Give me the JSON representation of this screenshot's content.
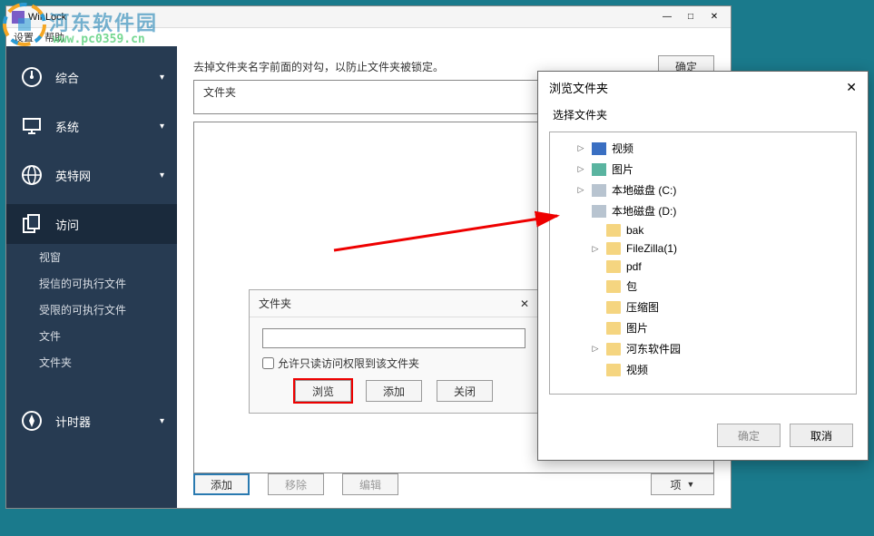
{
  "window": {
    "title": "WinLock"
  },
  "menu": {
    "item1": "设置",
    "item2": "帮助"
  },
  "sidebar": {
    "items": [
      {
        "label": "综合"
      },
      {
        "label": "系统"
      },
      {
        "label": "英特网"
      },
      {
        "label": "访问"
      },
      {
        "label": "计时器"
      }
    ],
    "sub": [
      {
        "label": "视窗"
      },
      {
        "label": "授信的可执行文件"
      },
      {
        "label": "受限的可执行文件"
      },
      {
        "label": "文件"
      },
      {
        "label": "文件夹"
      }
    ]
  },
  "panel": {
    "instruction": "去掉文件夹名字前面的对勾，以防止文件夹被锁定。",
    "list_header": "文件夹",
    "ok": "确定",
    "bottom": {
      "add": "添加",
      "remove": "移除",
      "edit": "编辑",
      "options": "项"
    }
  },
  "inner": {
    "title": "文件夹",
    "checkbox": "允许只读访问权限到该文件夹",
    "browse": "浏览",
    "add": "添加",
    "close": "关闭"
  },
  "browse": {
    "title": "浏览文件夹",
    "subtitle": "选择文件夹",
    "ok": "确定",
    "cancel": "取消",
    "tree": [
      {
        "label": "视频",
        "indent": 1,
        "icon": "vid",
        "exp": true
      },
      {
        "label": "图片",
        "indent": 1,
        "icon": "pic",
        "exp": true
      },
      {
        "label": "本地磁盘 (C:)",
        "indent": 1,
        "icon": "disk",
        "exp": true
      },
      {
        "label": "本地磁盘 (D:)",
        "indent": 1,
        "icon": "disk",
        "exp": false
      },
      {
        "label": "bak",
        "indent": 2,
        "icon": "folder",
        "exp": false
      },
      {
        "label": "FileZilla(1)",
        "indent": 2,
        "icon": "folder",
        "exp": true
      },
      {
        "label": "pdf",
        "indent": 2,
        "icon": "folder",
        "exp": false
      },
      {
        "label": "包",
        "indent": 2,
        "icon": "folder",
        "exp": false
      },
      {
        "label": "压缩图",
        "indent": 2,
        "icon": "folder",
        "exp": false
      },
      {
        "label": "图片",
        "indent": 2,
        "icon": "folder",
        "exp": false
      },
      {
        "label": "河东软件园",
        "indent": 2,
        "icon": "folder",
        "exp": true
      },
      {
        "label": "视频",
        "indent": 2,
        "icon": "folder",
        "exp": false
      }
    ]
  },
  "watermark": {
    "text": "河东软件园",
    "url": "www.pc0359.cn"
  }
}
